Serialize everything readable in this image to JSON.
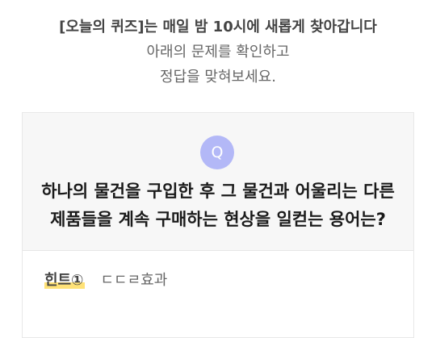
{
  "intro": {
    "line1": "[오늘의 퀴즈]는 매일 밤 10시에 새롭게 찾아갑니다",
    "line2": "아래의 문제를 확인하고",
    "line3": "정답을 맞혀보세요."
  },
  "quiz": {
    "badge": "Q",
    "question_line1": "하나의 물건을 구입한 후 그 물건과 어울리는 다른",
    "question_line2": "제품들을 계속 구매하는 현상을 일컫는 용어는?"
  },
  "hint": {
    "label": "힌트①",
    "value": "ㄷㄷㄹ효과",
    "highlight_color": "#ffd84a"
  },
  "colors": {
    "badge_bg": "#b3b8f7",
    "card_bg": "#f7f7f7"
  }
}
